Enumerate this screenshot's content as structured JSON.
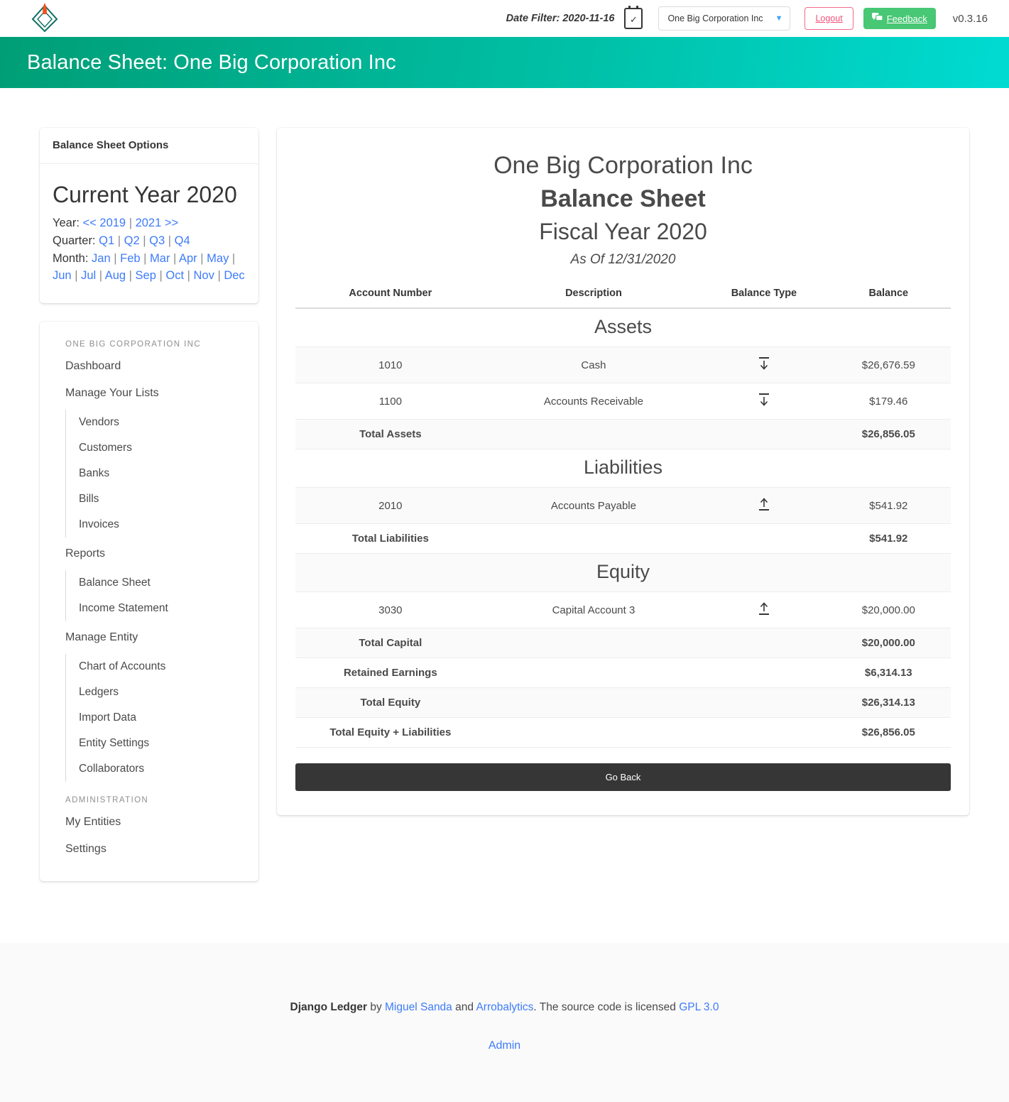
{
  "navbar": {
    "logo_icon": "django-ledger-diamond-logo",
    "date_filter_label": "Date Filter: 2020-11-16",
    "calendar_icon": "calendar-check-icon",
    "calendar_glyph": "✓",
    "entity_select_value": "One Big Corporation Inc",
    "entity_select_caret": "⌄",
    "logout_label": "Logout",
    "feedback_label": "Feedback",
    "feedback_icon": "chat-bubbles-icon",
    "version": "v0.3.16",
    "accent_green": "#48c774",
    "accent_red": "#f2527b"
  },
  "hero": {
    "title": "Balance Sheet: One Big Corporation Inc",
    "gradient_from": "#009e76",
    "gradient_to": "#00dbd2"
  },
  "options_card": {
    "header": "Balance Sheet Options",
    "current_year_title": "Current Year 2020",
    "year_label": "Year:",
    "year_links": [
      "<< 2019",
      "2021 >>"
    ],
    "quarter_label": "Quarter:",
    "quarter_links": [
      "Q1",
      "Q2",
      "Q3",
      "Q4"
    ],
    "month_label": "Month:",
    "month_links": [
      "Jan",
      "Feb",
      "Mar",
      "Apr",
      "May",
      "Jun",
      "Jul",
      "Aug",
      "Sep",
      "Oct",
      "Nov",
      "Dec"
    ],
    "link_color": "#3e7bfa"
  },
  "sidebar": {
    "entity_label": "ONE BIG CORPORATION INC",
    "admin_label": "ADMINISTRATION",
    "items": [
      {
        "label": "Dashboard"
      },
      {
        "label": "Manage Your Lists"
      },
      {
        "label": "Reports"
      },
      {
        "label": "Manage Entity"
      }
    ],
    "lists_sub": [
      {
        "label": "Vendors"
      },
      {
        "label": "Customers"
      },
      {
        "label": "Banks"
      },
      {
        "label": "Bills"
      },
      {
        "label": "Invoices"
      }
    ],
    "reports_sub": [
      {
        "label": "Balance Sheet"
      },
      {
        "label": "Income Statement"
      }
    ],
    "entity_sub": [
      {
        "label": "Chart of Accounts"
      },
      {
        "label": "Ledgers"
      },
      {
        "label": "Import Data"
      },
      {
        "label": "Entity Settings"
      },
      {
        "label": "Collaborators"
      }
    ],
    "admin_items": [
      {
        "label": "My Entities"
      },
      {
        "label": "Settings"
      }
    ]
  },
  "report": {
    "company": "One Big Corporation Inc",
    "title": "Balance Sheet",
    "fiscal_year": "Fiscal Year 2020",
    "as_of": "As Of 12/31/2020",
    "columns": [
      "Account Number",
      "Description",
      "Balance Type",
      "Balance"
    ],
    "go_back_label": "Go Back",
    "rows": [
      {
        "kind": "section",
        "label": "Assets",
        "shaded": false
      },
      {
        "kind": "account",
        "account": "1010",
        "description": "Cash",
        "balance_type": "debit",
        "balance": "$26,676.59",
        "shaded": true
      },
      {
        "kind": "account",
        "account": "1100",
        "description": "Accounts Receivable",
        "balance_type": "debit",
        "balance": "$179.46",
        "shaded": false
      },
      {
        "kind": "total",
        "label": "Total Assets",
        "value": "$26,856.05",
        "shaded": true
      },
      {
        "kind": "section",
        "label": "Liabilities",
        "shaded": false
      },
      {
        "kind": "account",
        "account": "2010",
        "description": "Accounts Payable",
        "balance_type": "credit",
        "balance": "$541.92",
        "shaded": true
      },
      {
        "kind": "total",
        "label": "Total Liabilities",
        "value": "$541.92",
        "shaded": false
      },
      {
        "kind": "section",
        "label": "Equity",
        "shaded": true
      },
      {
        "kind": "account",
        "account": "3030",
        "description": "Capital Account 3",
        "balance_type": "credit",
        "balance": "$20,000.00",
        "shaded": false
      },
      {
        "kind": "total",
        "label": "Total Capital",
        "value": "$20,000.00",
        "shaded": true
      },
      {
        "kind": "total",
        "label": "Retained Earnings",
        "value": "$6,314.13",
        "shaded": false
      },
      {
        "kind": "total",
        "label": "Total Equity",
        "value": "$26,314.13",
        "shaded": true
      },
      {
        "kind": "total",
        "label": "Total Equity + Liabilities",
        "value": "$26,856.05",
        "shaded": false
      }
    ]
  },
  "footer": {
    "brand": "Django Ledger",
    "by": " by ",
    "author": "Miguel Sanda",
    "and": " and ",
    "org": "Arrobalytics",
    "license_text": ". The source code is licensed ",
    "license": "GPL 3.0",
    "admin": "Admin"
  }
}
